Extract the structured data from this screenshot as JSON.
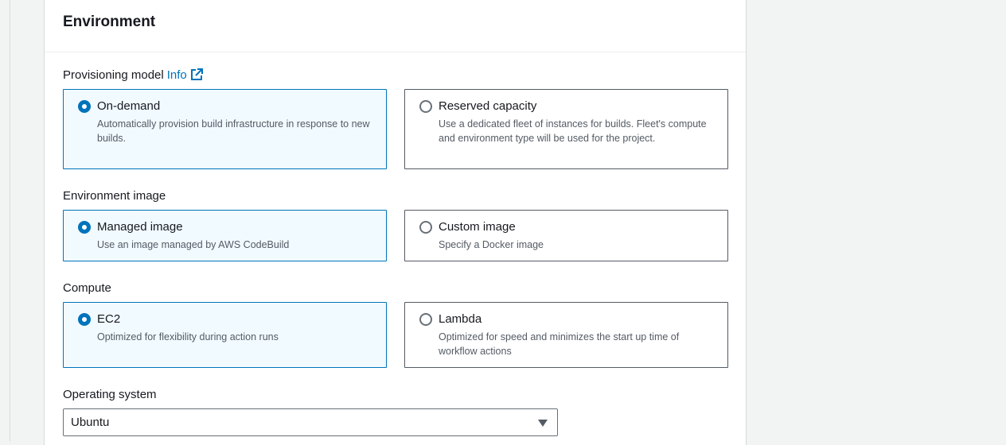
{
  "section": {
    "title": "Environment"
  },
  "provisioning": {
    "label": "Provisioning model",
    "info": "Info",
    "options": [
      {
        "title": "On-demand",
        "description": "Automatically provision build infrastructure in response to new builds.",
        "selected": true
      },
      {
        "title": "Reserved capacity",
        "description": "Use a dedicated fleet of instances for builds. Fleet's compute and environment type will be used for the project.",
        "selected": false
      }
    ]
  },
  "environment_image": {
    "label": "Environment image",
    "options": [
      {
        "title": "Managed image",
        "description": "Use an image managed by AWS CodeBuild",
        "selected": true
      },
      {
        "title": "Custom image",
        "description": "Specify a Docker image",
        "selected": false
      }
    ]
  },
  "compute": {
    "label": "Compute",
    "options": [
      {
        "title": "EC2",
        "description": "Optimized for flexibility during action runs",
        "selected": true
      },
      {
        "title": "Lambda",
        "description": "Optimized for speed and minimizes the start up time of workflow actions",
        "selected": false
      }
    ]
  },
  "operating_system": {
    "label": "Operating system",
    "value": "Ubuntu"
  },
  "colors": {
    "accent": "#0073bb",
    "selected_bg": "#f1faff",
    "page_bg": "#f2f3f3"
  },
  "icons": {
    "external_link": "external-link-icon",
    "dropdown": "caret-down-icon"
  }
}
